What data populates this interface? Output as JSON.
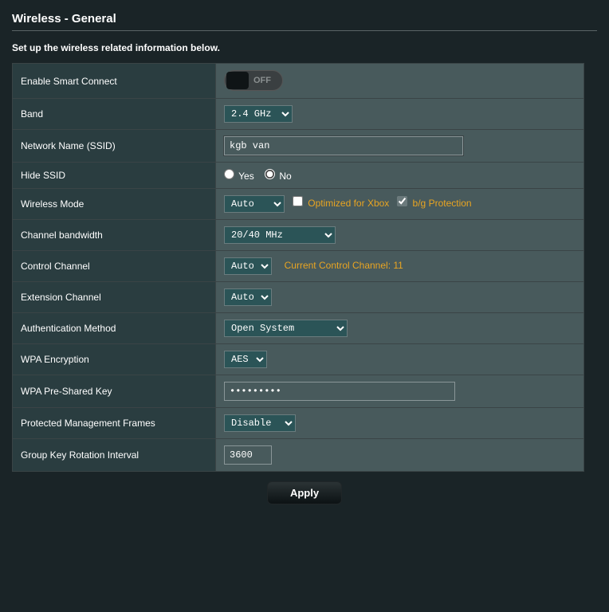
{
  "title": "Wireless - General",
  "description": "Set up the wireless related information below.",
  "rows": {
    "smart_connect": {
      "label": "Enable Smart Connect",
      "state": "OFF"
    },
    "band": {
      "label": "Band",
      "value": "2.4 GHz"
    },
    "ssid": {
      "label": "Network Name (SSID)",
      "value": "kgb van"
    },
    "hide_ssid": {
      "label": "Hide SSID",
      "yes": "Yes",
      "no": "No",
      "selected": "No"
    },
    "wireless_mode": {
      "label": "Wireless Mode",
      "value": "Auto",
      "opt_xbox": "Optimized for Xbox",
      "opt_bg": "b/g Protection",
      "opt_xbox_checked": false,
      "opt_bg_checked": true
    },
    "channel_bw": {
      "label": "Channel bandwidth",
      "value": "20/40 MHz"
    },
    "control_channel": {
      "label": "Control Channel",
      "value": "Auto",
      "current": "Current Control Channel: 11"
    },
    "ext_channel": {
      "label": "Extension Channel",
      "value": "Auto"
    },
    "auth_method": {
      "label": "Authentication Method",
      "value": "Open System"
    },
    "wpa_enc": {
      "label": "WPA Encryption",
      "value": "AES"
    },
    "wpa_psk": {
      "label": "WPA Pre-Shared Key",
      "value": "•••••••••"
    },
    "pmf": {
      "label": "Protected Management Frames",
      "value": "Disable"
    },
    "gkri": {
      "label": "Group Key Rotation Interval",
      "value": "3600"
    }
  },
  "apply": "Apply"
}
